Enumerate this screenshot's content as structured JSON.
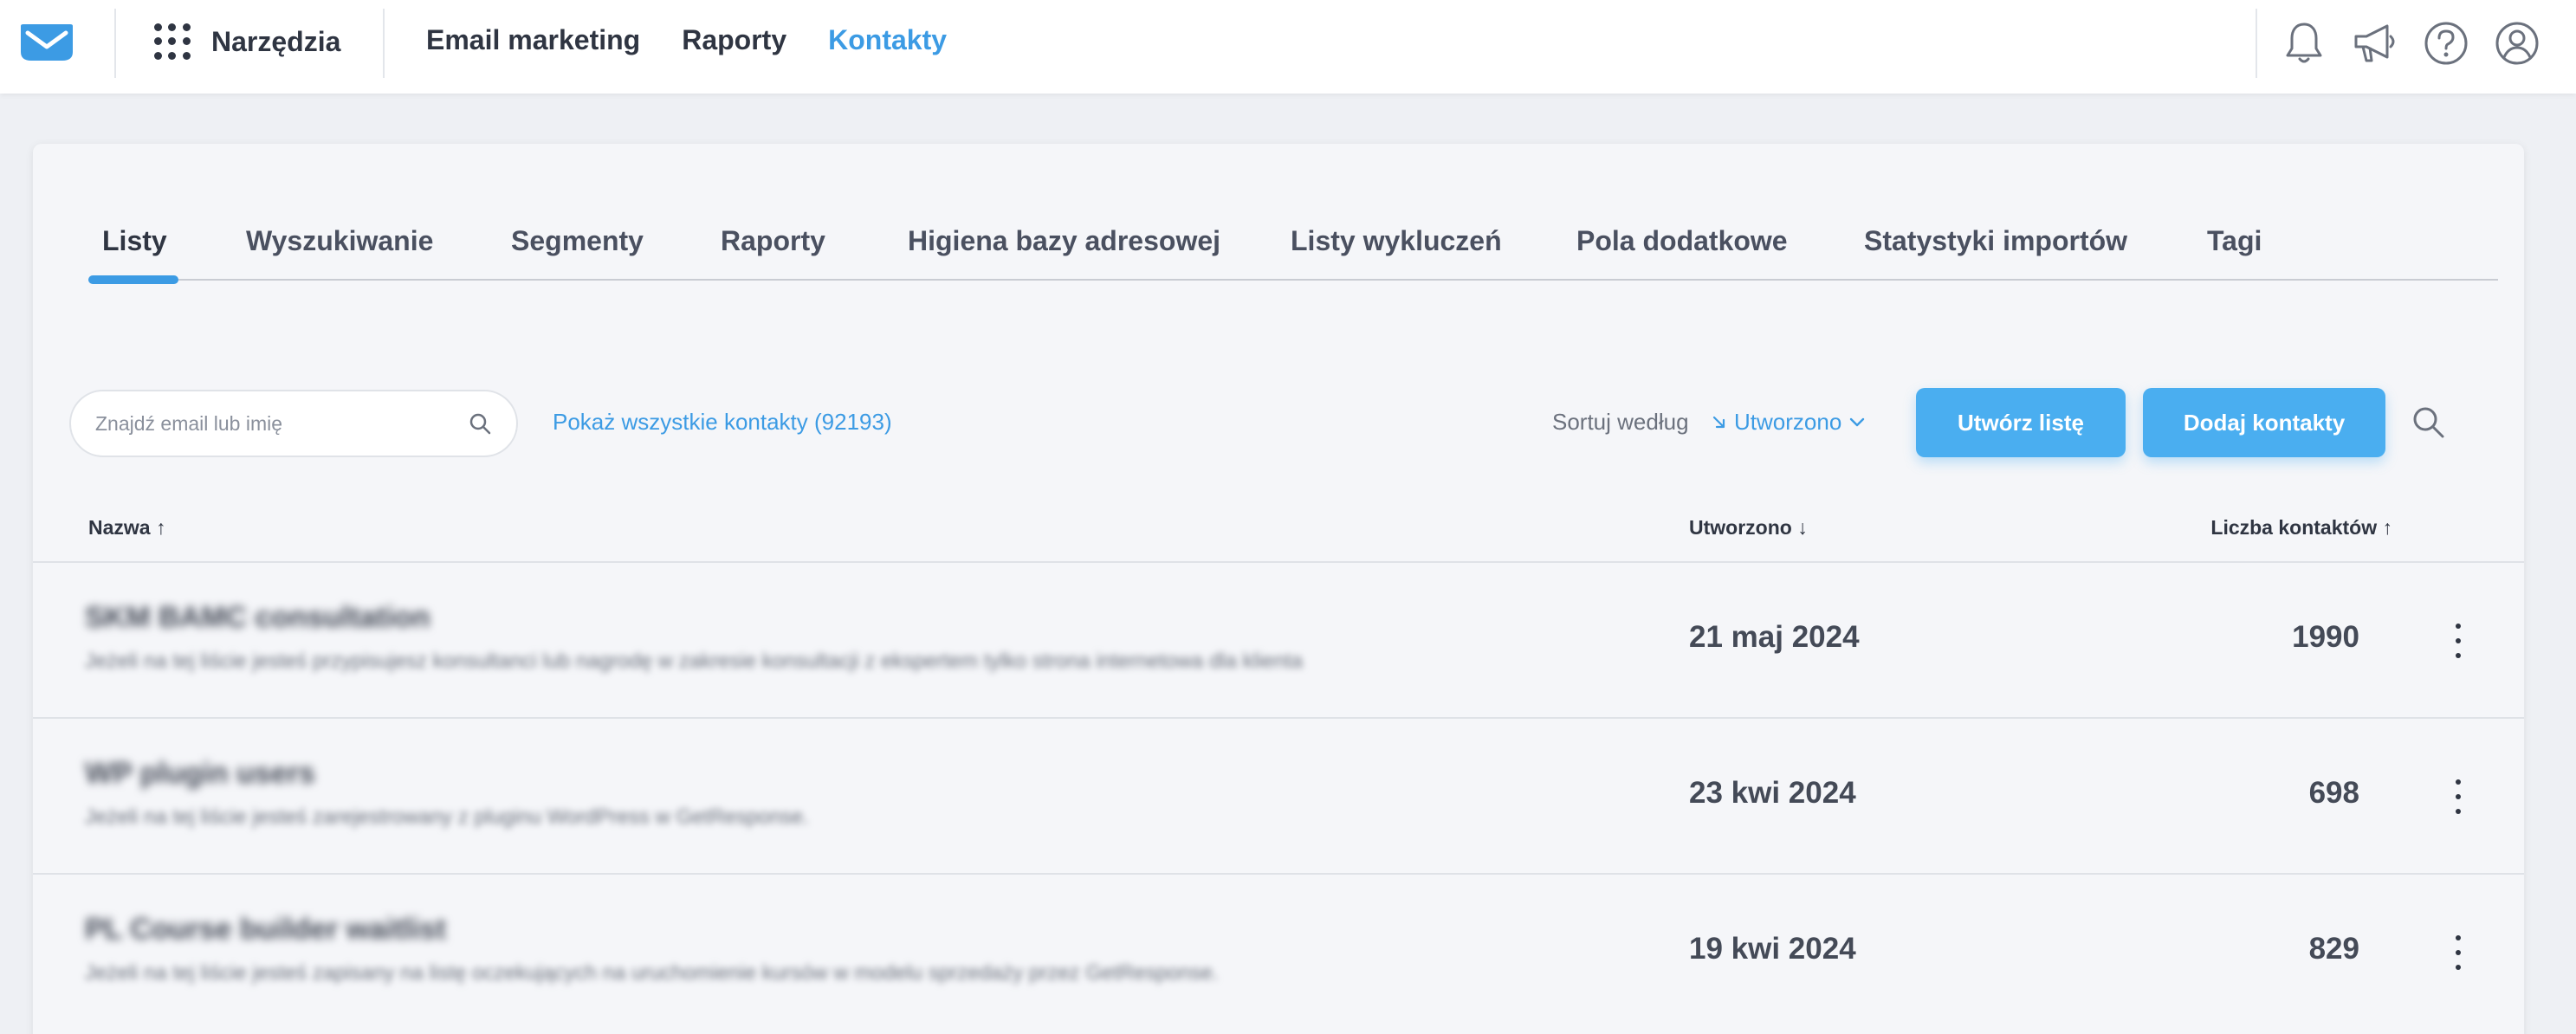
{
  "header": {
    "tools_label": "Narzędzia",
    "nav": [
      {
        "label": "Email marketing",
        "active": false
      },
      {
        "label": "Raporty",
        "active": false
      },
      {
        "label": "Kontakty",
        "active": true
      }
    ],
    "icons": [
      "bell-icon",
      "megaphone-icon",
      "help-icon",
      "user-account-icon"
    ]
  },
  "tabs": [
    {
      "label": "Listy",
      "active": true
    },
    {
      "label": "Wyszukiwanie"
    },
    {
      "label": "Segmenty"
    },
    {
      "label": "Raporty"
    },
    {
      "label": "Higiena bazy adresowej"
    },
    {
      "label": "Listy wykluczeń"
    },
    {
      "label": "Pola dodatkowe"
    },
    {
      "label": "Statystyki importów"
    },
    {
      "label": "Tagi"
    }
  ],
  "toolbar": {
    "search_placeholder": "Znajdź email lub imię",
    "show_all": "Pokaż wszystkie kontakty (92193)",
    "sort_label": "Sortuj według",
    "sort_value": "Utworzono",
    "create_list": "Utwórz listę",
    "add_contacts": "Dodaj kontakty"
  },
  "table": {
    "columns": {
      "name": "Nazwa",
      "created": "Utworzono",
      "count": "Liczba kontaktów"
    },
    "rows": [
      {
        "name": "SKM BAMC consultation",
        "description": "Jeżeli na tej liście jesteś przypisujesz konsultanci lub nagrodę w zakresie konsultacji z ekspertem tylko strona internetowa dla klienta",
        "created": "21 maj 2024",
        "count": "1990"
      },
      {
        "name": "WP plugin users",
        "description": "Jeżeli na tej liście jesteś zarejestrowany z pluginu WordPress w GetResponse.",
        "created": "23 kwi 2024",
        "count": "698"
      },
      {
        "name": "PL Course builder waitlist",
        "description": "Jeżeli na tej liście jesteś zapisany na listę oczekujących na uruchomienie kursów w modelu sprzedaży przez GetResponse.",
        "created": "19 kwi 2024",
        "count": "829"
      }
    ]
  },
  "colors": {
    "accent": "#3c9be4",
    "button": "#4aaef0",
    "text": "#2f3542",
    "background": "#eef0f4"
  }
}
